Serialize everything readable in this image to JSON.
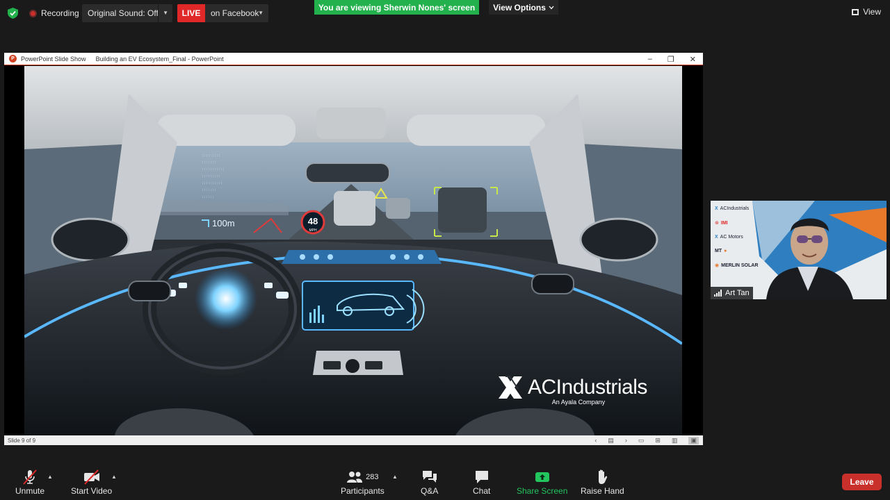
{
  "topbar": {
    "recording_label": "Recording",
    "sound_label": "Original Sound: Off",
    "live_label": "LIVE",
    "live_destination": "on Facebook",
    "viewing_banner": "You are viewing Sherwin Nones' screen",
    "view_options_label": "View Options",
    "view_label": "View"
  },
  "ppt": {
    "app_label": "PowerPoint Slide Show",
    "doc_title": "Building an EV Ecosystem_Final - PowerPoint",
    "slide_status": "Slide 9 of 9",
    "hud_speed": "48",
    "hud_speed_unit": "MPH",
    "hud_distance": "100m",
    "brand_name": "ACIndustrials",
    "brand_tagline": "An Ayala Company"
  },
  "video_tile": {
    "participant_name": "Art Tan",
    "bg_logos": [
      "ACIndustrials",
      "IMI",
      "AC Motors",
      "MT",
      "MERLIN SOLAR"
    ]
  },
  "toolbar": {
    "unmute_label": "Unmute",
    "start_video_label": "Start Video",
    "participants_label": "Participants",
    "participants_count": "283",
    "qa_label": "Q&A",
    "chat_label": "Chat",
    "share_screen_label": "Share Screen",
    "raise_hand_label": "Raise Hand",
    "leave_label": "Leave"
  },
  "colors": {
    "live_red": "#e02828",
    "banner_green": "#22b14c",
    "share_green": "#22c55e",
    "leave_red": "#c9302c",
    "ppt_orange": "#d04423"
  }
}
